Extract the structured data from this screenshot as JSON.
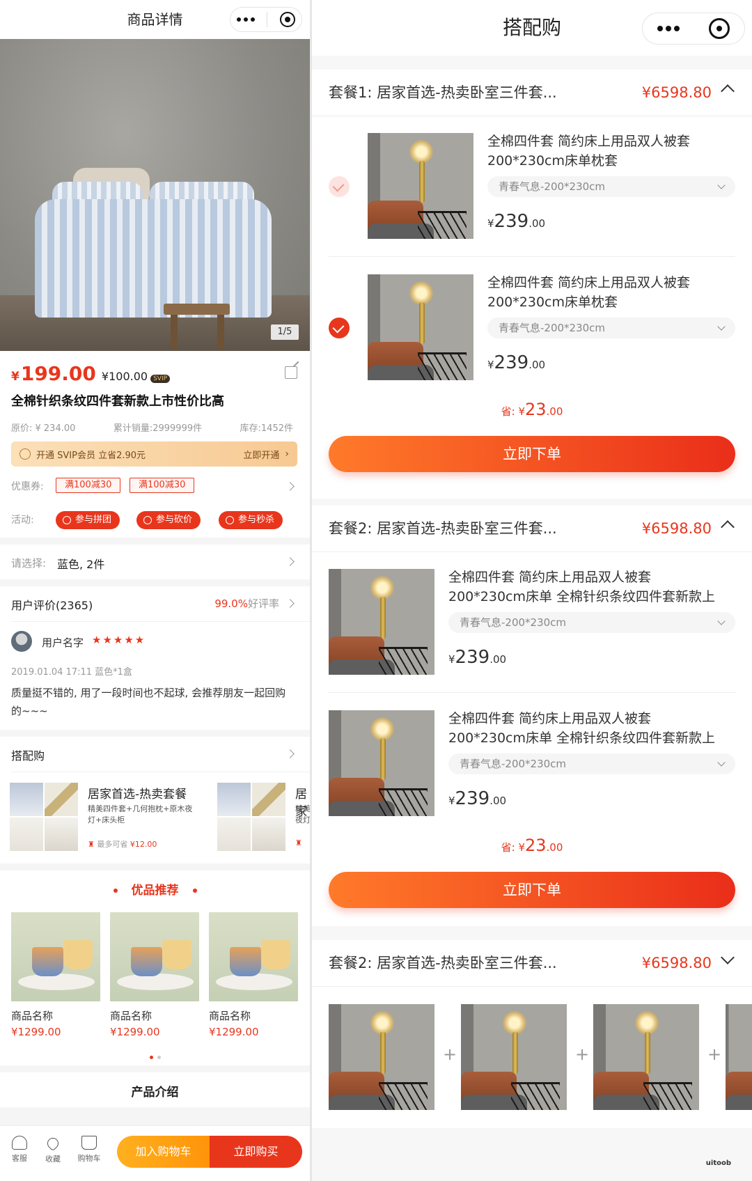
{
  "left": {
    "nav": {
      "title": "商品详情"
    },
    "hero": {
      "counter": "1/5"
    },
    "product": {
      "currency": "¥",
      "price": "199.00",
      "svip_price": "¥100.00",
      "svip_tag": "SVIP",
      "title": "全棉针织条纹四件套新款上市性价比高",
      "original_price": "原价: ¥ 234.00",
      "sales": "累计销量:2999999件",
      "stock": "库存:1452件"
    },
    "svip_bar": {
      "text": "开通 SVIP会员 立省2.90元",
      "action": "立即开通"
    },
    "coupons": {
      "label": "优惠券:",
      "items": [
        "满100减30",
        "满100减30"
      ]
    },
    "activities": {
      "label": "活动:",
      "items": [
        "参与拼团",
        "参与砍价",
        "参与秒杀"
      ]
    },
    "select": {
      "label": "请选择:",
      "value": "蓝色, 2件"
    },
    "review": {
      "header": "用户评价(2365)",
      "rate_value": "99.0%",
      "rate_suffix": "好评率",
      "user": "用户名字",
      "stars": "★★★★★",
      "date": "2019.01.04 17:11 蓝色*1盒",
      "text": "质量挺不错的, 用了一段时间也不起球, 会推荐朋友一起回购的~~~"
    },
    "combo": {
      "header": "搭配购",
      "items": [
        {
          "title": "居家首选-热卖套餐",
          "desc": "精美四件套+几何抱枕+原木夜灯+床头柜",
          "save_prefix": "最多可省",
          "save_value": "¥12.00"
        },
        {
          "title": "居家",
          "desc": "精美夜灯",
          "save_prefix": "",
          "save_value": ""
        }
      ]
    },
    "recommend": {
      "header": "优品推荐",
      "items": [
        {
          "name": "商品名称",
          "price": "¥1299.00"
        },
        {
          "name": "商品名称",
          "price": "¥1299.00"
        },
        {
          "name": "商品名称",
          "price": "¥1299.00"
        }
      ]
    },
    "intro": {
      "title": "产品介绍"
    },
    "bottom_bar": {
      "service": "客服",
      "favorite": "收藏",
      "cart": "购物车",
      "add_cart": "加入购物车",
      "buy_now": "立即购买"
    }
  },
  "right": {
    "nav": {
      "title": "搭配购"
    },
    "packages": [
      {
        "title": "套餐1: 居家首选-热卖卧室三件套...",
        "price": "¥6598.80",
        "items": [
          {
            "title": "全棉四件套 简约床上用品双人被套200*230cm床单枕套",
            "spec": "青春气息-200*230cm",
            "currency": "¥",
            "price_int": "239",
            "price_dec": ".00"
          },
          {
            "title": "全棉四件套 简约床上用品双人被套200*230cm床单枕套",
            "spec": "青春气息-200*230cm",
            "currency": "¥",
            "price_int": "239",
            "price_dec": ".00"
          }
        ],
        "saving_label": "省: ",
        "saving_cur": "¥",
        "saving_int": "23",
        "saving_dec": ".00",
        "order": "立即下单"
      },
      {
        "title": "套餐2: 居家首选-热卖卧室三件套...",
        "price": "¥6598.80",
        "items": [
          {
            "title": "全棉四件套 简约床上用品双人被套200*230cm床单 全棉针织条纹四件套新款上市性价...",
            "spec": "青春气息-200*230cm",
            "currency": "¥",
            "price_int": "239",
            "price_dec": ".00"
          },
          {
            "title": "全棉四件套 简约床上用品双人被套200*230cm床单 全棉针织条纹四件套新款上市性价...",
            "spec": "青春气息-200*230cm",
            "currency": "¥",
            "price_int": "239",
            "price_dec": ".00"
          }
        ],
        "saving_label": "省: ",
        "saving_cur": "¥",
        "saving_int": "23",
        "saving_dec": ".00",
        "order": "立即下单"
      },
      {
        "title": "套餐2: 居家首选-热卖卧室三件套...",
        "price": "¥6598.80",
        "plus": "+"
      }
    ],
    "watermark": "uitoob"
  }
}
